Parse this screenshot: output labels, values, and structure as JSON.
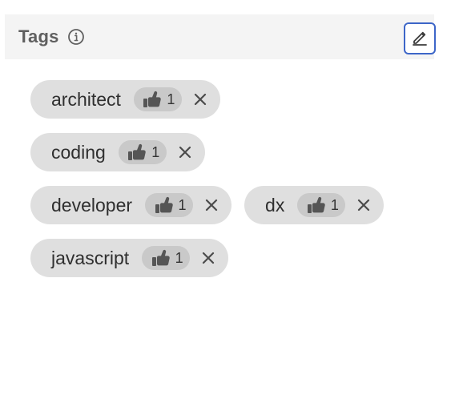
{
  "panel": {
    "title": "Tags",
    "icons": {
      "info": "info-icon",
      "edit": "pencil-icon",
      "vote": "thumbs-up-icon",
      "remove": "close-icon"
    }
  },
  "tags": [
    {
      "label": "architect",
      "votes": "1"
    },
    {
      "label": "coding",
      "votes": "1"
    },
    {
      "label": "developer",
      "votes": "1"
    },
    {
      "label": "dx",
      "votes": "1"
    },
    {
      "label": "javascript",
      "votes": "1"
    }
  ],
  "colors": {
    "header_bg": "#f4f4f4",
    "tag_bg": "#dfdfdf",
    "vote_bg": "#c9c9c9",
    "edit_border": "#3d66c8",
    "title_text": "#5f5f5f"
  }
}
